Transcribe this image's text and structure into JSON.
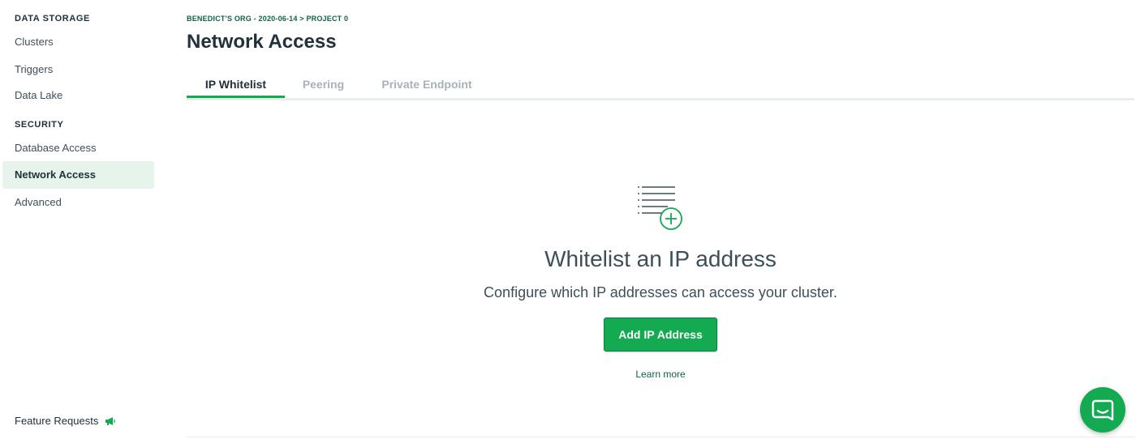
{
  "sidebar": {
    "data_storage_heading": "DATA STORAGE",
    "data_storage_items": [
      {
        "label": "Clusters"
      },
      {
        "label": "Triggers"
      },
      {
        "label": "Data Lake"
      }
    ],
    "security_heading": "SECURITY",
    "security_items": [
      {
        "label": "Database Access"
      },
      {
        "label": "Network Access",
        "active": true
      },
      {
        "label": "Advanced"
      }
    ],
    "feature_requests": {
      "label": "Feature Requests",
      "icon": "megaphone-icon"
    }
  },
  "header": {
    "breadcrumb": "BENEDICT'S ORG - 2020-06-14 > PROJECT 0",
    "title": "Network Access"
  },
  "tabs": [
    {
      "label": "IP Whitelist",
      "active": true
    },
    {
      "label": "Peering"
    },
    {
      "label": "Private Endpoint"
    }
  ],
  "empty_state": {
    "icon": "list-add-icon",
    "title": "Whitelist an IP address",
    "description": "Configure which IP addresses can access your cluster.",
    "button_label": "Add IP Address",
    "link_label": "Learn more"
  },
  "chat": {
    "icon": "chat-icon"
  },
  "colors": {
    "accent": "#13aa52",
    "dark_green": "#116149",
    "active_bg": "#e7f4ec",
    "text": "#21313c",
    "muted_tab": "#a8b3b7"
  }
}
